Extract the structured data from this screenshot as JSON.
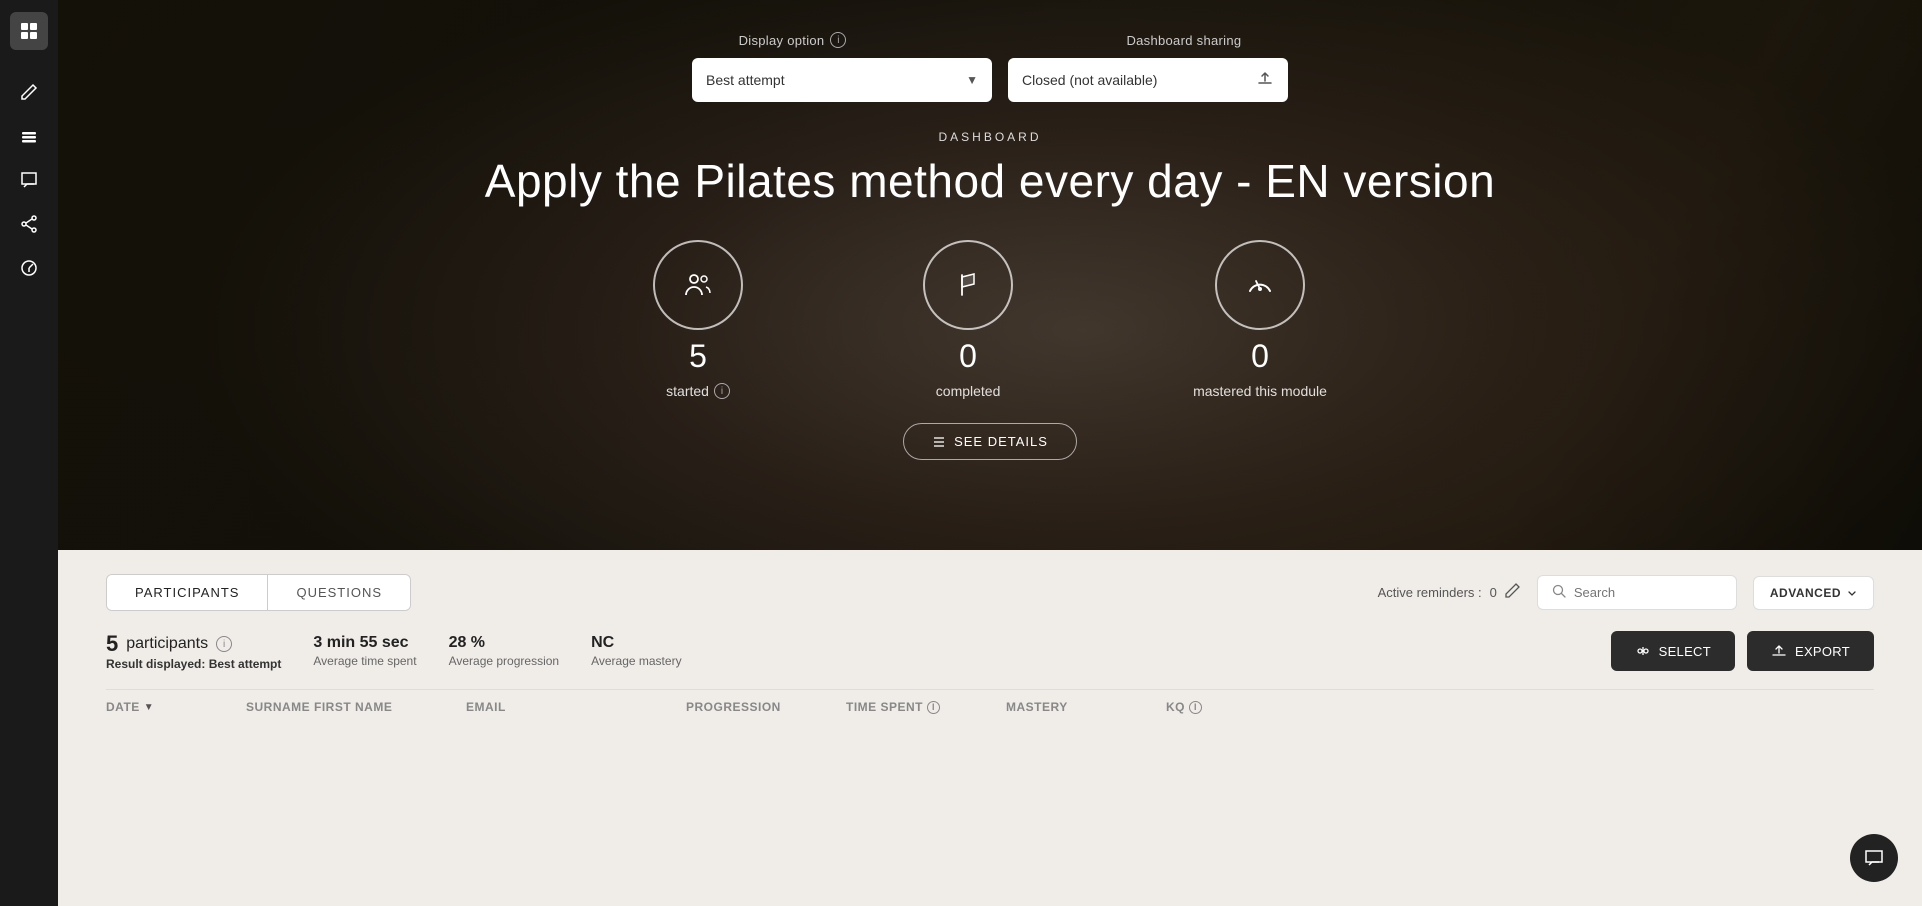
{
  "sidebar": {
    "logo_icon": "grid-icon",
    "items": [
      {
        "id": "edit",
        "icon": "pencil-icon",
        "label": "Edit"
      },
      {
        "id": "layers",
        "icon": "layers-icon",
        "label": "Layers"
      },
      {
        "id": "chat",
        "icon": "chat-icon",
        "label": "Chat"
      },
      {
        "id": "share",
        "icon": "share-icon",
        "label": "Share"
      },
      {
        "id": "analytics",
        "icon": "analytics-icon",
        "label": "Analytics"
      }
    ]
  },
  "hero": {
    "display_option_label": "Display option",
    "dashboard_sharing_label": "Dashboard sharing",
    "dropdown_value": "Best attempt",
    "sharing_value": "Closed (not available)",
    "section_label": "DASHBOARD",
    "title": "Apply the Pilates method every day - EN version",
    "stats": [
      {
        "value": "5",
        "label": "started",
        "has_info": true,
        "icon": "people-icon"
      },
      {
        "value": "0",
        "label": "completed",
        "has_info": false,
        "icon": "flag-icon"
      },
      {
        "value": "0",
        "label": "mastered this module",
        "has_info": false,
        "icon": "gauge-icon"
      }
    ],
    "see_details_button": "SEE DETAILS"
  },
  "lower": {
    "tabs": [
      {
        "id": "participants",
        "label": "PARTICIPANTS",
        "active": true
      },
      {
        "id": "questions",
        "label": "QUESTIONS",
        "active": false
      }
    ],
    "active_reminders_label": "Active reminders :",
    "active_reminders_count": "0",
    "search_placeholder": "Search",
    "advanced_button": "ADVANCED",
    "participants_count": "5",
    "participants_label": "participants",
    "result_displayed_label": "Result displayed:",
    "result_displayed_value": "Best attempt",
    "average_time_value": "3 min 55 sec",
    "average_time_label": "Average time spent",
    "average_progression_value": "28 %",
    "average_progression_label": "Average progression",
    "average_mastery_value": "NC",
    "average_mastery_label": "Average mastery",
    "select_button": "SELECT",
    "export_button": "EXPORT",
    "table_columns": [
      {
        "id": "date",
        "label": "DATE",
        "sortable": true
      },
      {
        "id": "name",
        "label": "SURNAME FIRST NAME",
        "sortable": false
      },
      {
        "id": "email",
        "label": "EMAIL",
        "sortable": false
      },
      {
        "id": "progression",
        "label": "PROGRESSION",
        "sortable": false
      },
      {
        "id": "time_spent",
        "label": "TIME SPENT",
        "sortable": false,
        "has_info": true
      },
      {
        "id": "mastery",
        "label": "MASTERY",
        "sortable": false
      },
      {
        "id": "kq",
        "label": "KQ",
        "sortable": false,
        "has_info": true
      }
    ]
  }
}
